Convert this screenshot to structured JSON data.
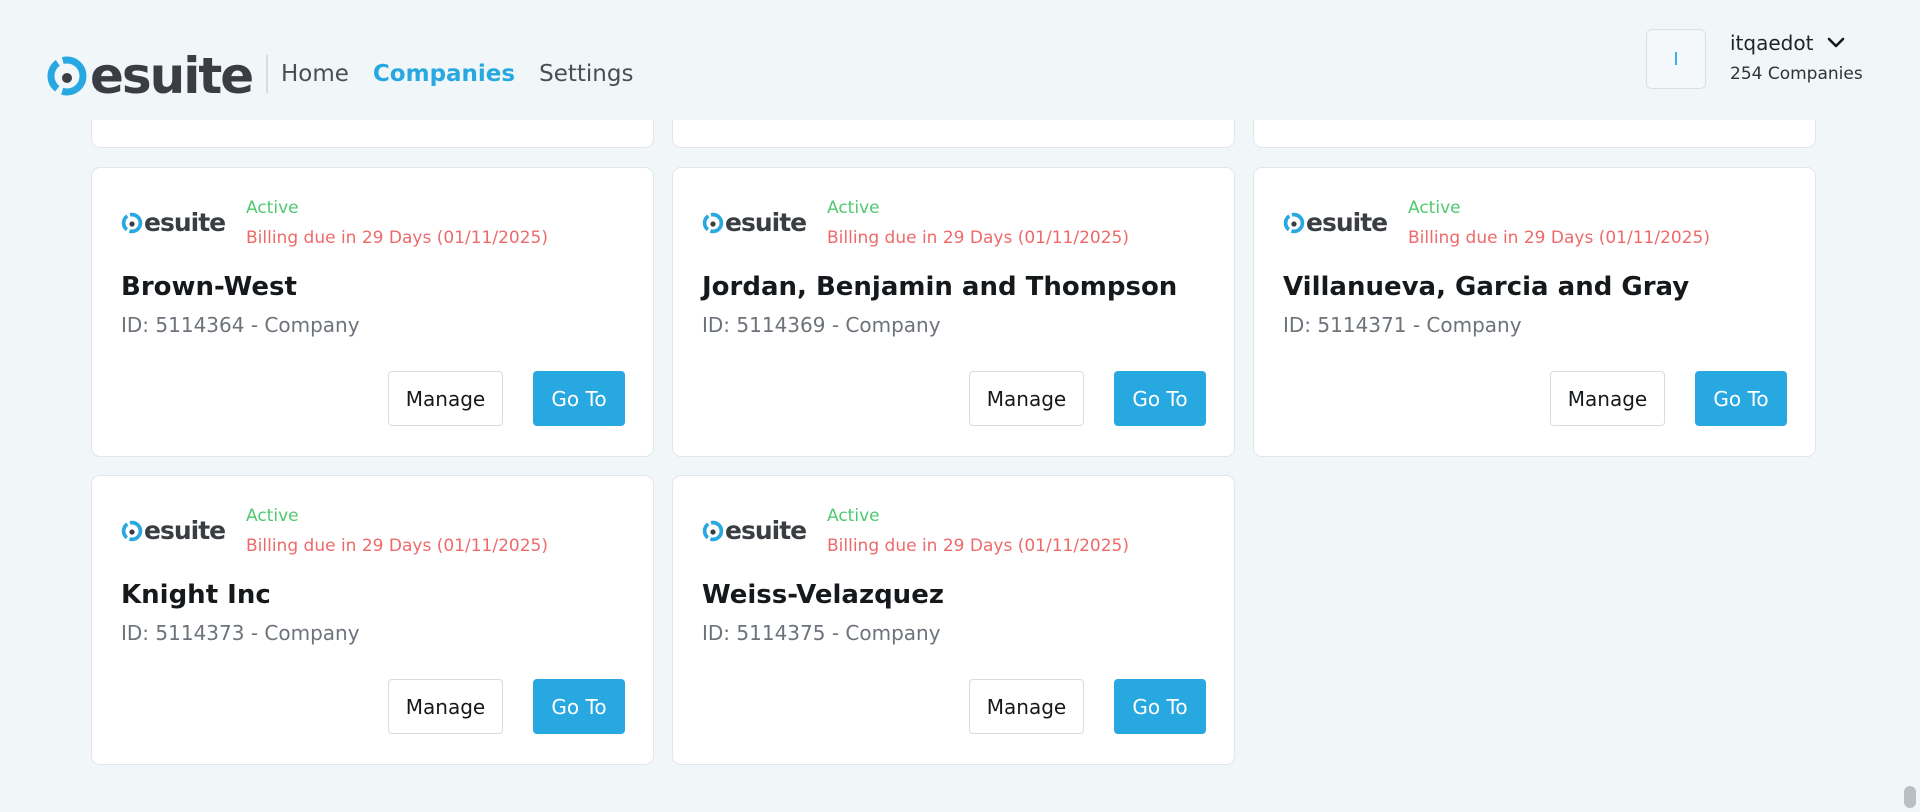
{
  "header": {
    "logo_text": "esuite",
    "nav": [
      {
        "label": "Home",
        "active": false
      },
      {
        "label": "Companies",
        "active": true
      },
      {
        "label": "Settings",
        "active": false
      }
    ],
    "user": {
      "avatar_initial": "I",
      "name": "itqaedot",
      "subtitle": "254 Companies",
      "dropdown_icon": "chevron-down-icon"
    }
  },
  "brand": {
    "accent": "#28a8e0",
    "active_color": "#4fc96f",
    "billing_color": "#ee6a6a"
  },
  "cards": [
    {
      "logo": "esuite",
      "status": "Active",
      "billing": "Billing due in 29 Days (01/11/2025)",
      "name": "Brown-West",
      "id_line": "ID: 5114364 - Company",
      "manage": "Manage",
      "goto": "Go To"
    },
    {
      "logo": "esuite",
      "status": "Active",
      "billing": "Billing due in 29 Days (01/11/2025)",
      "name": "Jordan, Benjamin and Thompson",
      "id_line": "ID: 5114369 - Company",
      "manage": "Manage",
      "goto": "Go To"
    },
    {
      "logo": "esuite",
      "status": "Active",
      "billing": "Billing due in 29 Days (01/11/2025)",
      "name": "Villanueva, Garcia and Gray",
      "id_line": "ID: 5114371 - Company",
      "manage": "Manage",
      "goto": "Go To"
    },
    {
      "logo": "esuite",
      "status": "Active",
      "billing": "Billing due in 29 Days (01/11/2025)",
      "name": "Knight Inc",
      "id_line": "ID: 5114373 - Company",
      "manage": "Manage",
      "goto": "Go To"
    },
    {
      "logo": "esuite",
      "status": "Active",
      "billing": "Billing due in 29 Days (01/11/2025)",
      "name": "Weiss-Velazquez",
      "id_line": "ID: 5114375 - Company",
      "manage": "Manage",
      "goto": "Go To"
    }
  ]
}
